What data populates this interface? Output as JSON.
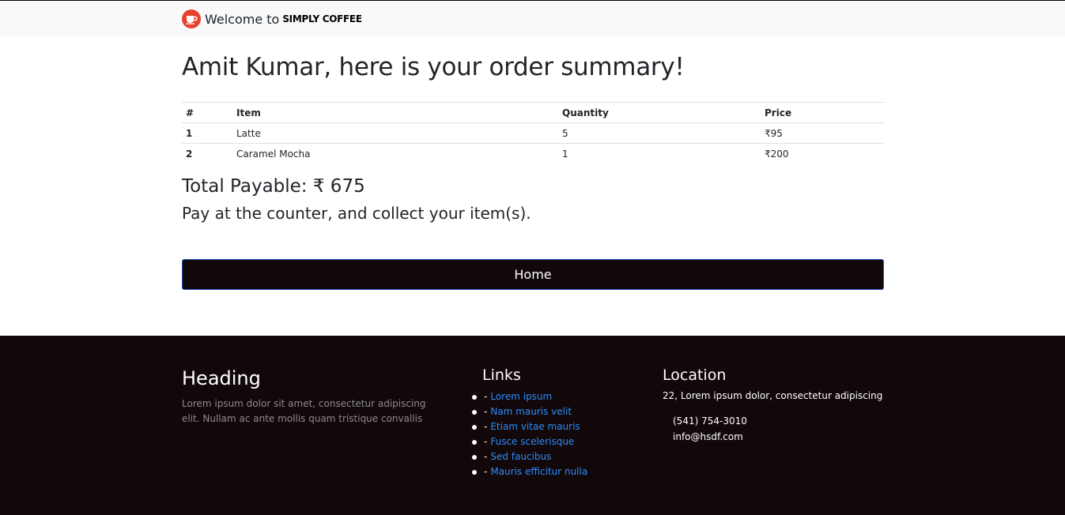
{
  "navbar": {
    "welcome": "Welcome to",
    "brand": "SIMPLY COFFEE",
    "logo_icon": "coffee-cup-icon"
  },
  "summary": {
    "title": "Amit Kumar, here is your order summary!",
    "table": {
      "headers": [
        "#",
        "Item",
        "Quantity",
        "Price"
      ],
      "rows": [
        {
          "index": "1",
          "item": "Latte",
          "quantity": "5",
          "price": "₹95"
        },
        {
          "index": "2",
          "item": "Caramel Mocha",
          "quantity": "1",
          "price": "₹200"
        }
      ]
    },
    "total": "Total Payable: ₹ 675",
    "note": "Pay at the counter, and collect your item(s).",
    "home_label": "Home"
  },
  "footer": {
    "heading": "Heading",
    "lorem": "Lorem ipsum dolor sit amet, consectetur adipiscing elit. Nullam ac ante mollis quam tristique convallis",
    "links_title": "Links",
    "links": [
      "Lorem ipsum",
      "Nam mauris velit",
      "Etiam vitae mauris",
      "Fusce scelerisque",
      "Sed faucibus",
      "Mauris efficitur nulla"
    ],
    "location_title": "Location",
    "address": "22, Lorem ipsum dolor, consectetur adipiscing",
    "phone": "(541) 754-3010",
    "email": "info@hsdf.com"
  },
  "colors": {
    "footer_bg": "#120809",
    "link": "#2b8cff",
    "logo": "#e8412c"
  }
}
